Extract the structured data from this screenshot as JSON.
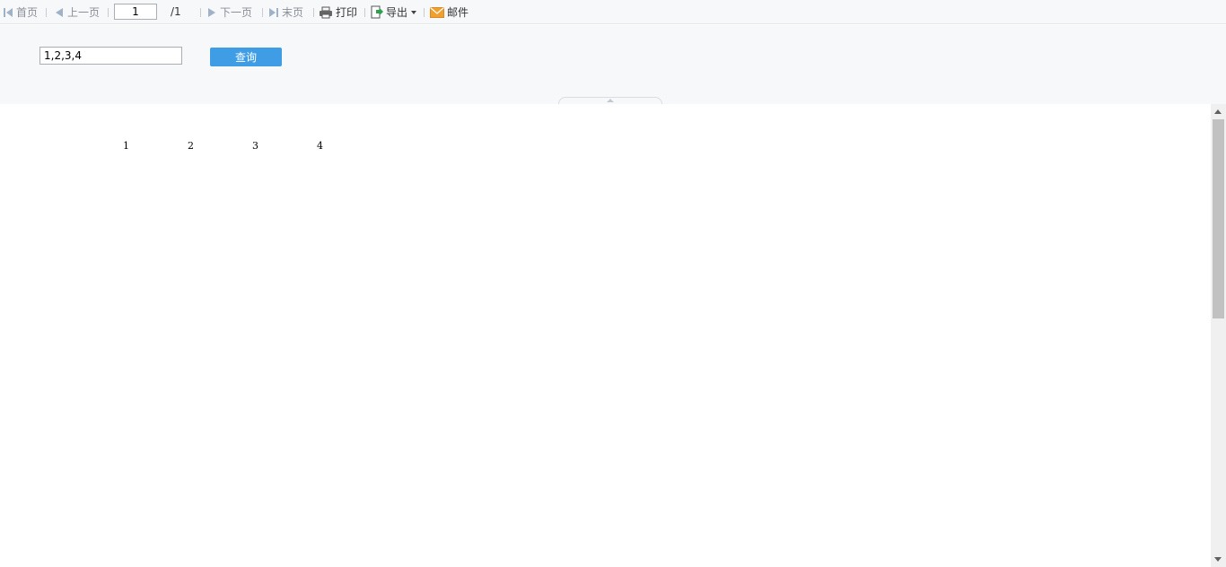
{
  "toolbar": {
    "first_label": "首页",
    "prev_label": "上一页",
    "page_current": "1",
    "page_total": "/1",
    "next_label": "下一页",
    "last_label": "末页",
    "print_label": "打印",
    "export_label": "导出",
    "mail_label": "邮件"
  },
  "params": {
    "input_value": "1,2,3,4",
    "query_label": "查询"
  },
  "report": {
    "cells": [
      "1",
      "2",
      "3",
      "4"
    ]
  },
  "colors": {
    "accent": "#3f9de6",
    "disabled_icon": "#9fb2c8",
    "mail_icon": "#f0a030",
    "export_icon": "#2aa14a"
  }
}
